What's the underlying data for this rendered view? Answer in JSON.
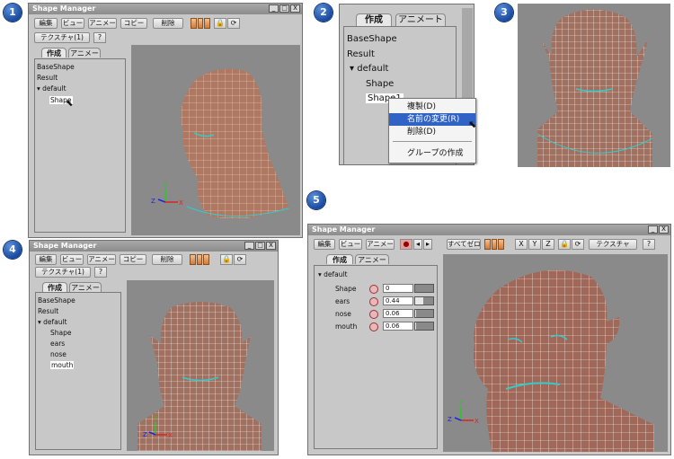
{
  "steps": [
    "1",
    "2",
    "3",
    "4",
    "5"
  ],
  "window_title": "Shape Manager",
  "titlebar_buttons": [
    "_",
    "□",
    "X"
  ],
  "toolbar": {
    "edit": "編集",
    "view": "ビュー",
    "anime": "アニメー",
    "copy": "コピー",
    "delete": "削除",
    "texture1": "テクスチャ(1)",
    "texture": "テクスチャ",
    "zero_all": "すべてゼロ",
    "help": "?",
    "x": "X",
    "y": "Y",
    "z": "Z"
  },
  "tabs": {
    "create": "作成",
    "anime": "アニメート"
  },
  "tree": {
    "base": "BaseShape",
    "result": "Result",
    "group": "default",
    "shape": "Shape",
    "shape_editing": "Shape1",
    "ears": "ears",
    "nose": "nose",
    "mouth": "mouth"
  },
  "context_menu": [
    "複製(D)",
    "名前の変更(R)",
    "削除(D)",
    "グループの作成"
  ],
  "context_menu_highlight": 1,
  "sliders": [
    {
      "label": "Shape",
      "value": "0",
      "fill": 0.0
    },
    {
      "label": "ears",
      "value": "0.44",
      "fill": 0.44
    },
    {
      "label": "nose",
      "value": "0.06",
      "fill": 0.06
    },
    {
      "label": "mouth",
      "value": "0.06",
      "fill": 0.06
    }
  ],
  "axis": {
    "x": "X",
    "y": "Y",
    "z": "Z"
  }
}
